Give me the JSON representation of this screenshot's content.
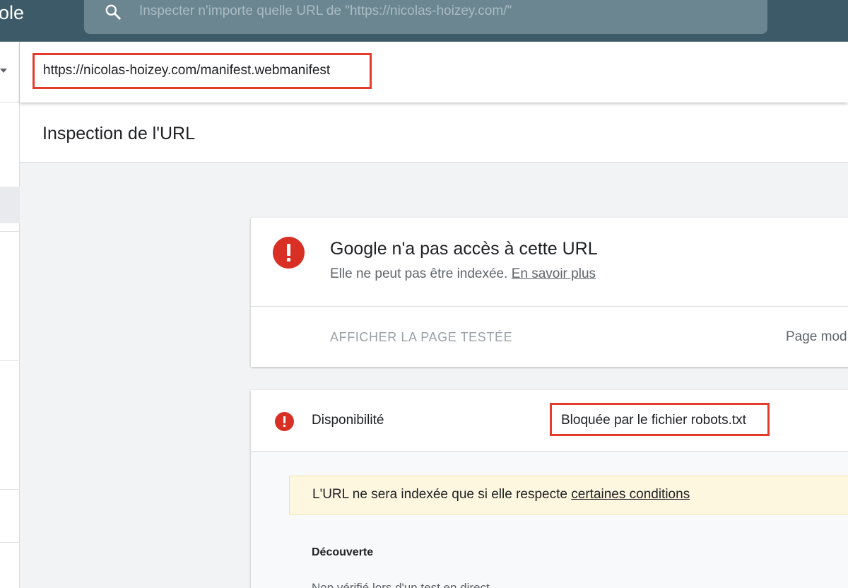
{
  "app": {
    "title_fragment": "ole"
  },
  "search": {
    "placeholder": "Inspecter n'importe quelle URL de \"https://nicolas-hoizey.com/\""
  },
  "url_bar": {
    "inspected_url": "https://nicolas-hoizey.com/manifest.webmanifest"
  },
  "page": {
    "title": "Inspection de l'URL"
  },
  "status": {
    "title": "Google n'a pas accès à cette URL",
    "subtitle": "Elle ne peut pas être indexée.",
    "learn_more": "En savoir plus",
    "view_tested_page": "AFFICHER LA PAGE TESTÉE",
    "right_label": "Page mod"
  },
  "availability": {
    "label": "Disponibilité",
    "value": "Bloquée par le fichier robots.txt",
    "warning_text": "L'URL ne sera indexée que si elle respecte",
    "warning_link": "certaines conditions",
    "section_label": "Découverte",
    "cutoff_text": "Non vérifié lors d'un test en direct"
  },
  "colors": {
    "topbar": "#3c5a67",
    "searchbox": "#6b8691",
    "error": "#d93025",
    "highlight": "#e53b2c",
    "warning_bg": "#fef7e0"
  },
  "icons": [
    "search-icon",
    "chevron-down-icon",
    "error-icon"
  ]
}
